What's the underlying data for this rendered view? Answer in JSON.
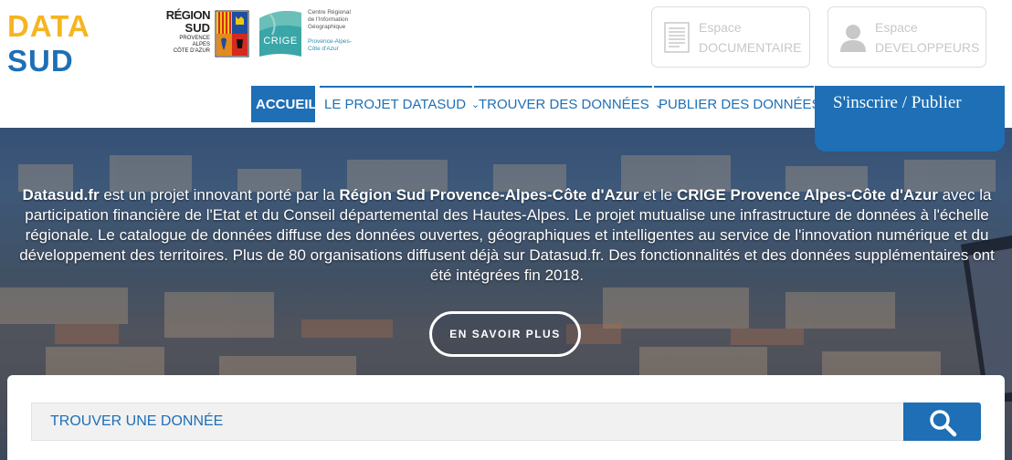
{
  "header": {
    "logo": {
      "line1": "DATA",
      "line2": "SUD"
    },
    "region_logo": {
      "line1": "RÉGION",
      "line2": "SUD",
      "line3": "PROVENCE\nALPES\nCÔTE D'AZUR"
    },
    "crige_logo": {
      "badge": "CRIGE",
      "caption_top": "Centre Régional\nde l'Information\nGéographique",
      "caption_bottom": "Provence-Alpes-\nCôte d'Azur"
    },
    "espaces": [
      {
        "line1": "Espace",
        "line2": "DOCUMENTAIRE",
        "icon": "document-icon"
      },
      {
        "line1": "Espace",
        "line2": "DEVELOPPEURS",
        "icon": "user-icon"
      }
    ],
    "nav": [
      {
        "label": "ACCUEIL",
        "active": true
      },
      {
        "label": "LE PROJET DATASUD",
        "dropdown": true
      },
      {
        "label": "TROUVER DES DONNÉES",
        "dropdown": true
      },
      {
        "label": "PUBLIER DES DONNÉES"
      }
    ],
    "signup_label": "S'inscrire / Publier"
  },
  "hero": {
    "intro": {
      "p1_bold": "Datasud.fr",
      "p1": " est un projet innovant porté par la ",
      "p2_bold": "Région Sud Provence-Alpes-Côte d'Azur",
      "p2": " et le ",
      "p3_bold": "CRIGE Provence Alpes-Côte d'Azur",
      "p3": " avec la participation financière de l'Etat et du Conseil départemental des Hautes-Alpes. Le projet mutualise une infrastructure de données à l'échelle régionale. Le catalogue de données diffuse des données ouvertes, géographiques et intelligentes au service de l'innovation numérique et du développement des territoires. Plus de 80 organisations diffusent déjà sur Datasud.fr. Des fonctionnalités et des données supplémentaires ont été intégrées fin 2018."
    },
    "more_button": "EN SAVOIR PLUS"
  },
  "search": {
    "placeholder": "TROUVER UNE DONNÉE",
    "icon": "search-icon"
  },
  "colors": {
    "brand_blue": "#1e6fb5",
    "brand_yellow": "#f6b520"
  }
}
